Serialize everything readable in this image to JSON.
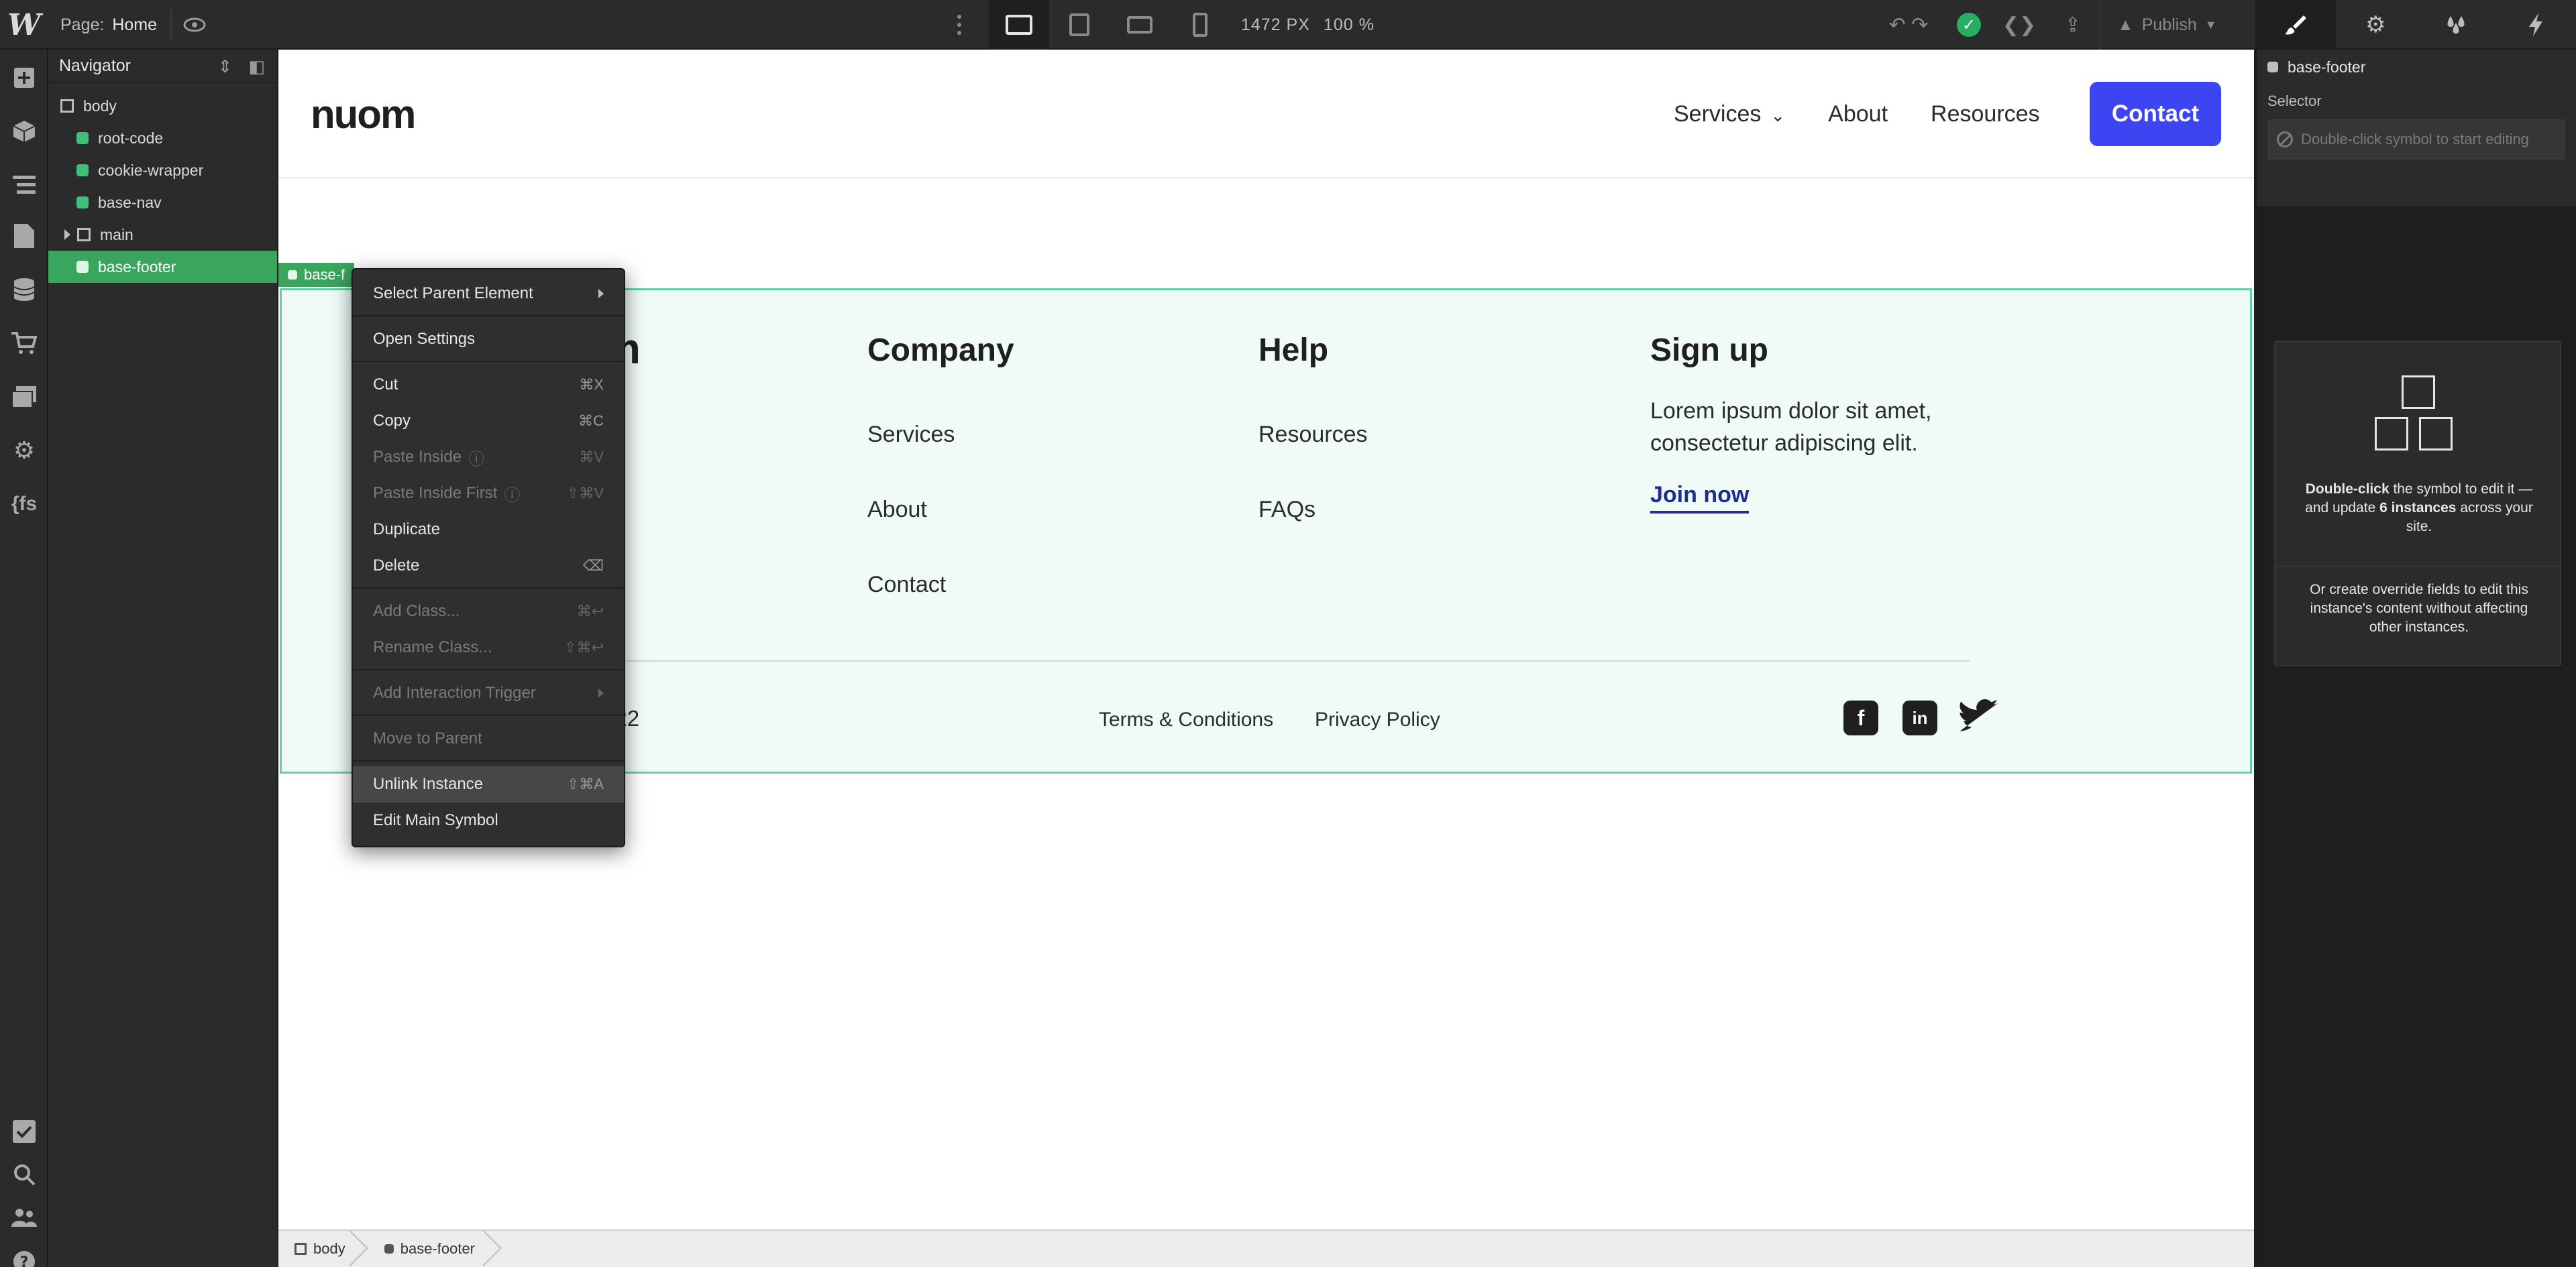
{
  "topbar": {
    "logo": "W",
    "page_label": "Page:",
    "page_name": "Home",
    "size_readout": "1472 PX",
    "zoom_readout": "100 %",
    "publish_label": "Publish"
  },
  "navigator": {
    "title": "Navigator",
    "items": [
      {
        "label": "body"
      },
      {
        "label": "root-code"
      },
      {
        "label": "cookie-wrapper"
      },
      {
        "label": "base-nav"
      },
      {
        "label": "main"
      },
      {
        "label": "base-footer"
      }
    ]
  },
  "site": {
    "logo": "nuom",
    "menu": {
      "services": "Services",
      "about": "About",
      "resources": "Resources"
    },
    "contact_label": "Contact"
  },
  "footer": {
    "logo_fragment": "m",
    "company": {
      "title": "Company",
      "links": [
        "Services",
        "About",
        "Contact"
      ]
    },
    "help": {
      "title": "Help",
      "links": [
        "Resources",
        "FAQs"
      ]
    },
    "signup": {
      "title": "Sign up",
      "text": "Lorem ipsum dolor sit amet, consectetur adipiscing elit.",
      "cta": "Join now"
    },
    "year_fragment": "022",
    "legal": {
      "terms": "Terms & Conditions",
      "privacy": "Privacy Policy"
    }
  },
  "selection_tag": "base-f",
  "context_menu": {
    "items": [
      {
        "label": "Select Parent Element",
        "shortcut": ""
      },
      {
        "label": "Open Settings",
        "shortcut": ""
      },
      {
        "label": "Cut",
        "shortcut": "⌘X"
      },
      {
        "label": "Copy",
        "shortcut": "⌘C"
      },
      {
        "label": "Paste Inside",
        "shortcut": "⌘V"
      },
      {
        "label": "Paste Inside First",
        "shortcut": "⇧⌘V"
      },
      {
        "label": "Duplicate",
        "shortcut": ""
      },
      {
        "label": "Delete",
        "shortcut": "⌫"
      },
      {
        "label": "Add Class...",
        "shortcut": "⌘↩"
      },
      {
        "label": "Rename Class...",
        "shortcut": "⇧⌘↩"
      },
      {
        "label": "Add Interaction Trigger",
        "shortcut": ""
      },
      {
        "label": "Move to Parent",
        "shortcut": ""
      },
      {
        "label": "Unlink Instance",
        "shortcut": "⇧⌘A"
      },
      {
        "label": "Edit Main Symbol",
        "shortcut": ""
      }
    ]
  },
  "breadcrumb": {
    "items": [
      "body",
      "base-footer"
    ]
  },
  "panel": {
    "element_name": "base-footer",
    "selector_label": "Selector",
    "selector_placeholder": "Double-click symbol to start editing",
    "info_bold1": "Double-click",
    "info_text1": " the symbol to edit it — and update ",
    "info_bold2": "6 instances",
    "info_text2": " across your site.",
    "override_text": "Or create override fields to edit this instance's content without affecting other instances."
  },
  "colors": {
    "accent_green": "#3aa55d",
    "contact_blue": "#3d44f2",
    "join_link": "#1e2d8e",
    "footer_bg": "#f0fbf7",
    "publish_check": "#27ae60"
  },
  "icons": {
    "rail": [
      "add-icon",
      "cube-icon",
      "navigator-icon",
      "pages-icon",
      "cms-icon",
      "ecommerce-icon",
      "assets-icon",
      "settings-icon",
      "code-icon",
      "checklist-icon",
      "search-icon",
      "users-icon",
      "help-icon"
    ],
    "panel_tabs": [
      "brush-icon",
      "gear-icon",
      "drops-icon",
      "bolt-icon"
    ]
  }
}
